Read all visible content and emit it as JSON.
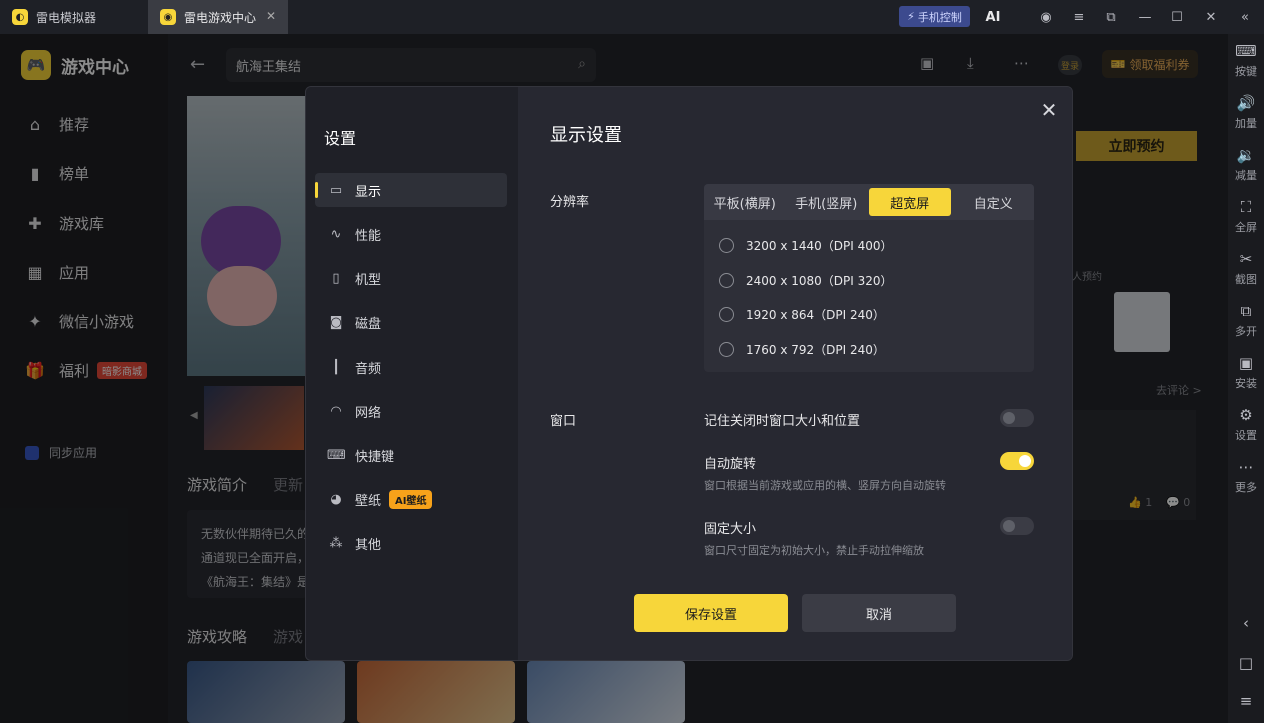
{
  "titlebar": {
    "tab1": "雷电模拟器",
    "tab2": "雷电游戏中心",
    "phone_control": "手机控制"
  },
  "brand": {
    "name": "游戏中心"
  },
  "nav": {
    "items": [
      {
        "label": "推荐"
      },
      {
        "label": "榜单"
      },
      {
        "label": "游戏库"
      },
      {
        "label": "应用"
      },
      {
        "label": "微信小游戏"
      },
      {
        "label": "福利",
        "badge": "暗影商城"
      }
    ],
    "sync": "同步应用"
  },
  "header": {
    "search_value": "航海王集结",
    "login": "登录",
    "welfare": "领取福利券"
  },
  "page": {
    "reserve": "立即预约",
    "section_tabs": [
      "游戏简介",
      "更新"
    ],
    "intro_lines": [
      "无数伙伴期待已久的",
      "通道现已全面开启，",
      "《航海王：集结》是"
    ],
    "guide_tabs": [
      "游戏攻略",
      "游戏"
    ],
    "people_reserved": "人预约",
    "go_comment": "去评论 >",
    "likes": "1",
    "comments": "0"
  },
  "right_toolbar": [
    {
      "label": "按键"
    },
    {
      "label": "加量"
    },
    {
      "label": "减量"
    },
    {
      "label": "全屏"
    },
    {
      "label": "截图"
    },
    {
      "label": "多开"
    },
    {
      "label": "安装"
    },
    {
      "label": "设置"
    },
    {
      "label": "更多"
    }
  ],
  "modal": {
    "side_title": "设置",
    "menu": [
      {
        "label": "显示",
        "icon": "monitor-icon"
      },
      {
        "label": "性能",
        "icon": "pulse-icon"
      },
      {
        "label": "机型",
        "icon": "phone-icon"
      },
      {
        "label": "磁盘",
        "icon": "disk-icon"
      },
      {
        "label": "音频",
        "icon": "audio-icon"
      },
      {
        "label": "网络",
        "icon": "wifi-icon"
      },
      {
        "label": "快捷键",
        "icon": "keyboard-icon"
      },
      {
        "label": "壁纸",
        "icon": "palette-icon",
        "badge": "AI壁纸"
      },
      {
        "label": "其他",
        "icon": "grid-icon"
      }
    ],
    "heading": "显示设置",
    "resolution": {
      "label": "分辨率",
      "tabs": [
        "平板(横屏)",
        "手机(竖屏)",
        "超宽屏",
        "自定义"
      ],
      "active_tab": "超宽屏",
      "options": [
        "3200 x 1440（DPI 400）",
        "2400 x 1080（DPI 320）",
        "1920 x 864（DPI 240）",
        "1760 x 792（DPI 240）"
      ]
    },
    "window": {
      "label": "窗口",
      "remember": {
        "title": "记住关闭时窗口大小和位置",
        "on": false
      },
      "auto_rotate": {
        "title": "自动旋转",
        "desc": "窗口根据当前游戏或应用的横、竖屏方向自动旋转",
        "on": true
      },
      "fixed_size": {
        "title": "固定大小",
        "desc": "窗口尺寸固定为初始大小，禁止手动拉伸缩放",
        "on": false
      }
    },
    "save": "保存设置",
    "cancel": "取消"
  },
  "colors": {
    "accent": "#f7d63a",
    "modal_bg": "#25262e",
    "app_bg": "#1b1c20"
  }
}
